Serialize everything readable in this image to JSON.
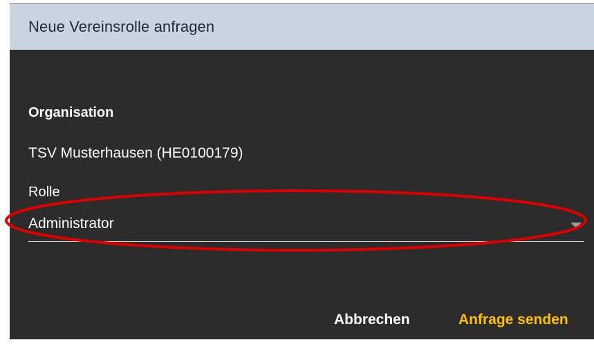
{
  "dialog": {
    "title": "Neue Vereinsrolle anfragen",
    "organisation_label": "Organisation",
    "organisation_value": "TSV Musterhausen (HE0100179)",
    "role_label": "Rolle",
    "role_value": "Administrator",
    "cancel_label": "Abbrechen",
    "send_label": "Anfrage senden"
  },
  "colors": {
    "header_bg": "#c9d6e2",
    "dialog_bg": "#2c2c2c",
    "accent": "#ffc000",
    "highlight": "#e00000"
  },
  "icons": {
    "dropdown": "chevron-down-icon"
  }
}
